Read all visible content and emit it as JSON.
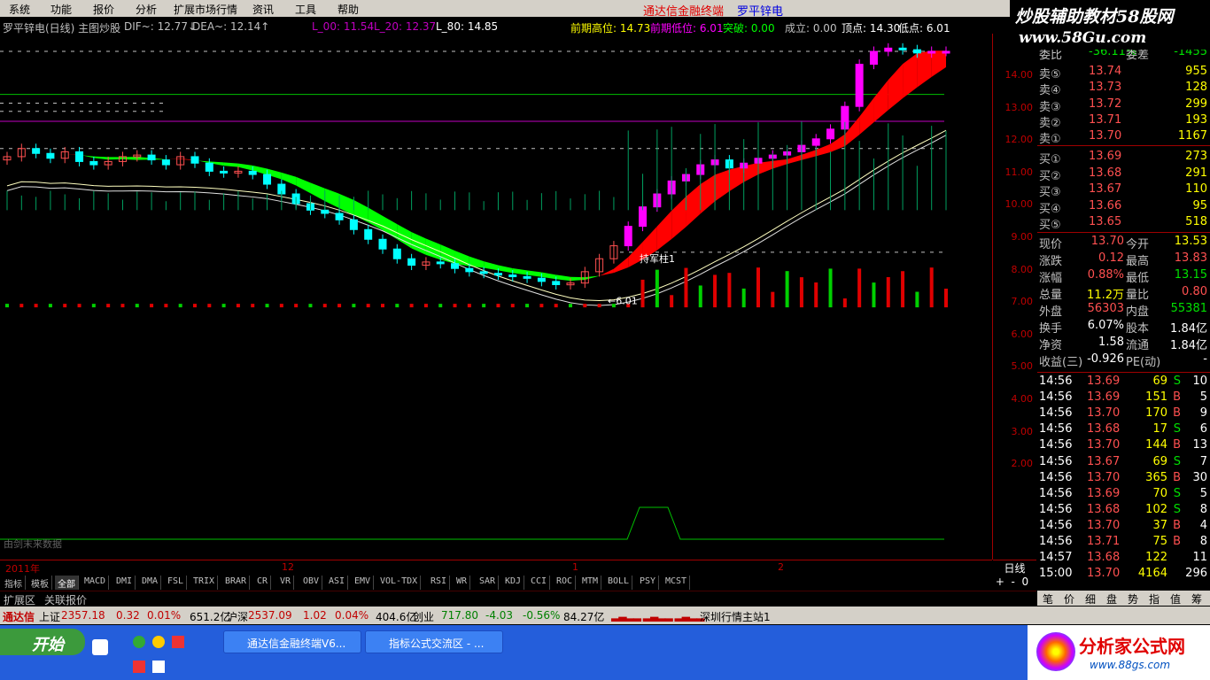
{
  "menu": [
    "系统",
    "功能",
    "报价",
    "分析",
    "扩展市场行情",
    "资讯",
    "工具",
    "帮助"
  ],
  "app_title": "通达信金融终端",
  "stock_title": "罗平锌电",
  "logo": {
    "text": "炒股辅助教材58股网",
    "url": "www.58Gu.com"
  },
  "info_bar": {
    "name": "罗平锌电(日线) 主图炒股",
    "dif": "DIF~: 12.77↓",
    "dea": "DEA~: 12.14↑",
    "l00": "L_00: 11.54",
    "l20": "L_20: 12.37",
    "l80": "L_80: 14.85",
    "prev_high": "前期高位: 14.73",
    "prev_low": "前期低位: 6.01",
    "breakout": "突破: 0.00",
    "volume": "成立: 0.00",
    "top": "顶点: 14.30",
    "bottom": "低点: 6.01"
  },
  "chart_labels": {
    "high": "14.30",
    "low": "6.01",
    "hold": "持军柱1",
    "watermark": "由剑末来数据"
  },
  "yaxis": [
    "14.00",
    "13.00",
    "12.00",
    "11.00",
    "10.00",
    "9.00",
    "8.00",
    "7.00",
    "6.00",
    "5.00",
    "4.00",
    "3.00",
    "2.00"
  ],
  "xaxis": [
    "2011年",
    "12",
    "1",
    "2"
  ],
  "period_label": "日线",
  "tabs": [
    "指标",
    "模板",
    "全部",
    "MACD",
    "DMI",
    "DMA",
    "FSL",
    "TRIX",
    "BRAR",
    "CR",
    "VR",
    "OBV",
    "ASI",
    "EMV",
    "VOL-TDX",
    "RSI",
    "WR",
    "SAR",
    "KDJ",
    "CCI",
    "ROC",
    "MTM",
    "BOLL",
    "PSY",
    "MCST"
  ],
  "bottom_tabs": [
    "扩展区",
    "关联报价"
  ],
  "panel": {
    "top_row": {
      "l1": "委比",
      "v1": "-36.11%",
      "l2": "委差",
      "v2": "-1455"
    },
    "sells": [
      {
        "label": "卖⑤",
        "price": "13.74",
        "vol": "955"
      },
      {
        "label": "卖④",
        "price": "13.73",
        "vol": "128"
      },
      {
        "label": "卖③",
        "price": "13.72",
        "vol": "299"
      },
      {
        "label": "卖②",
        "price": "13.71",
        "vol": "193"
      },
      {
        "label": "卖①",
        "price": "13.70",
        "vol": "1167"
      }
    ],
    "buys": [
      {
        "label": "买①",
        "price": "13.69",
        "vol": "273"
      },
      {
        "label": "买②",
        "price": "13.68",
        "vol": "291"
      },
      {
        "label": "买③",
        "price": "13.67",
        "vol": "110"
      },
      {
        "label": "买④",
        "price": "13.66",
        "vol": "95"
      },
      {
        "label": "买⑤",
        "price": "13.65",
        "vol": "518"
      }
    ],
    "stats": [
      {
        "l1": "现价",
        "v1": "13.70",
        "l2": "今开",
        "v2": "13.53"
      },
      {
        "l1": "涨跌",
        "v1": "0.12",
        "l2": "最高",
        "v2": "13.83"
      },
      {
        "l1": "涨幅",
        "v1": "0.88%",
        "l2": "最低",
        "v2": "13.15"
      },
      {
        "l1": "总量",
        "v1": "11.2万",
        "l2": "量比",
        "v2": "0.80"
      },
      {
        "l1": "外盘",
        "v1": "56303",
        "l2": "内盘",
        "v2": "55381"
      },
      {
        "l1": "换手",
        "v1": "6.07%",
        "l2": "股本",
        "v2": "1.84亿"
      },
      {
        "l1": "净资",
        "v1": "1.58",
        "l2": "流通",
        "v2": "1.84亿"
      },
      {
        "l1": "收益(三)",
        "v1": "-0.926",
        "l2": "PE(动)",
        "v2": "-"
      }
    ],
    "ticks": [
      {
        "t": "14:56",
        "p": "13.69",
        "v": "69",
        "bs": "S",
        "n": "10"
      },
      {
        "t": "14:56",
        "p": "13.69",
        "v": "151",
        "bs": "B",
        "n": "5"
      },
      {
        "t": "14:56",
        "p": "13.70",
        "v": "170",
        "bs": "B",
        "n": "9"
      },
      {
        "t": "14:56",
        "p": "13.68",
        "v": "17",
        "bs": "S",
        "n": "6"
      },
      {
        "t": "14:56",
        "p": "13.70",
        "v": "144",
        "bs": "B",
        "n": "13"
      },
      {
        "t": "14:56",
        "p": "13.67",
        "v": "69",
        "bs": "S",
        "n": "7"
      },
      {
        "t": "14:56",
        "p": "13.70",
        "v": "365",
        "bs": "B",
        "n": "30"
      },
      {
        "t": "14:56",
        "p": "13.69",
        "v": "70",
        "bs": "S",
        "n": "5"
      },
      {
        "t": "14:56",
        "p": "13.68",
        "v": "102",
        "bs": "S",
        "n": "8"
      },
      {
        "t": "14:56",
        "p": "13.70",
        "v": "37",
        "bs": "B",
        "n": "4"
      },
      {
        "t": "14:56",
        "p": "13.71",
        "v": "75",
        "bs": "B",
        "n": "8"
      },
      {
        "t": "14:57",
        "p": "13.68",
        "v": "122",
        "bs": "",
        "n": "11"
      },
      {
        "t": "15:00",
        "p": "13.70",
        "v": "4164",
        "bs": "",
        "n": "296"
      }
    ],
    "icons": [
      "笔",
      "价",
      "细",
      "盘",
      "势",
      "指",
      "值",
      "筹"
    ]
  },
  "status": {
    "brand": "通达信",
    "sh_label": "上证",
    "sh": "2357.18",
    "sh_chg": "0.32",
    "sh_pct": "0.01%",
    "sh_amt": "651.2亿",
    "sz_label": "沪深",
    "sz": "2537.09",
    "sz_chg": "1.02",
    "sz_pct": "0.04%",
    "sz_amt": "404.6亿",
    "cy_label": "创业",
    "cy": "717.80",
    "cy_chg": "-4.03",
    "cy_pct": "-0.56%",
    "cy_amt": "84.27亿",
    "server": "深圳行情主站1"
  },
  "taskbar": {
    "start": "开始",
    "tasks": [
      "通达信金融终端V6...",
      "指标公式交流区 - ..."
    ]
  },
  "ad": {
    "text": "分析家公式网",
    "url": "www.88gs.com"
  },
  "chart_data": {
    "type": "candlestick",
    "ylim": [
      1.0,
      15.0
    ],
    "closes": [
      10.45,
      10.7,
      10.55,
      10.4,
      10.6,
      10.3,
      10.2,
      10.3,
      10.45,
      10.5,
      10.35,
      10.2,
      10.45,
      10.25,
      10.0,
      9.95,
      10.0,
      9.9,
      9.6,
      9.3,
      9.0,
      8.8,
      8.7,
      8.5,
      8.2,
      7.9,
      7.6,
      7.3,
      7.1,
      7.2,
      7.15,
      7.0,
      6.9,
      6.85,
      6.8,
      6.75,
      6.7,
      6.6,
      6.5,
      6.55,
      6.9,
      7.3,
      7.7,
      8.3,
      8.9,
      9.3,
      9.7,
      9.9,
      10.2,
      10.35,
      10.1,
      10.25,
      10.4,
      10.5,
      10.6,
      10.8,
      11.0,
      11.3,
      12.0,
      13.3,
      13.7,
      13.8,
      13.75,
      13.65,
      13.7,
      13.7
    ]
  }
}
